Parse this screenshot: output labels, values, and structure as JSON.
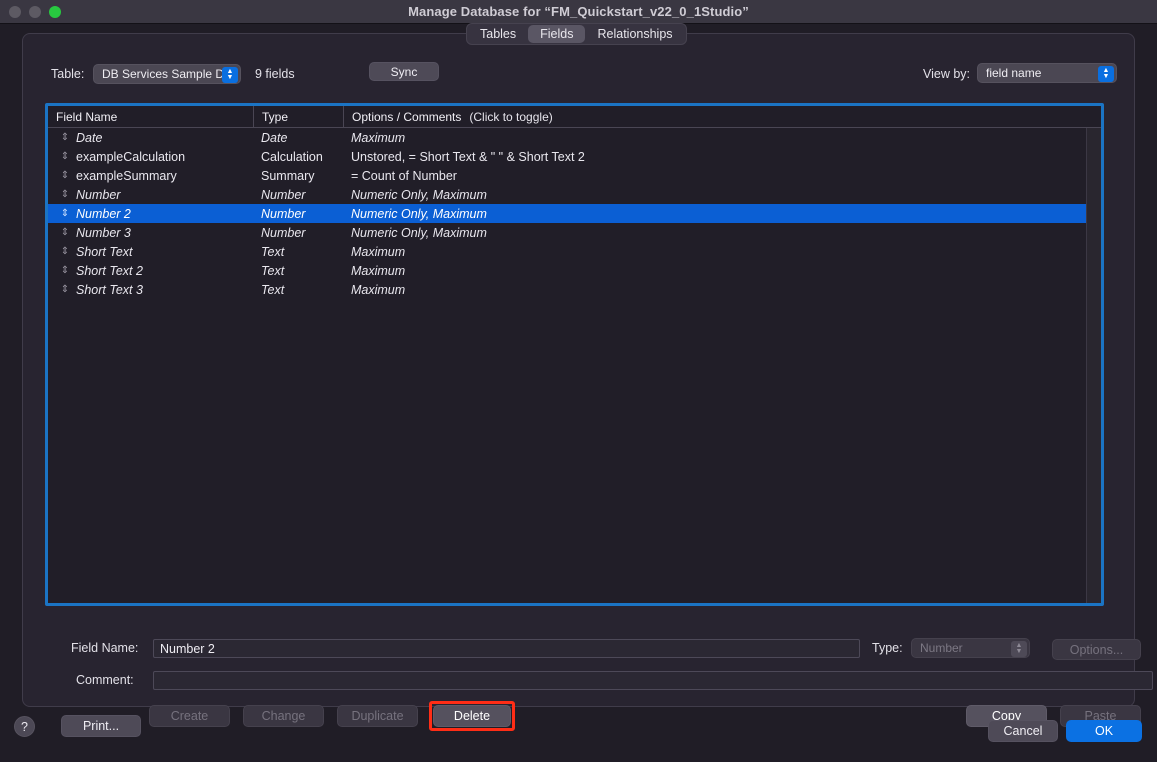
{
  "window": {
    "title": "Manage Database for “FM_Quickstart_v22_0_1Studio”",
    "traffic_lights": [
      "close",
      "minimize",
      "maximize"
    ]
  },
  "tabs": [
    {
      "label": "Tables",
      "active": false
    },
    {
      "label": "Fields",
      "active": true
    },
    {
      "label": "Relationships",
      "active": false
    }
  ],
  "toolbar": {
    "table_label": "Table:",
    "table_value": "DB Services Sample D...",
    "fields_count": "9 fields",
    "sync_label": "Sync",
    "viewby_label": "View by:",
    "viewby_value": "field name"
  },
  "list": {
    "columns": [
      "Field Name",
      "Type",
      "Options / Comments"
    ],
    "columns_hint": "(Click to toggle)",
    "rows": [
      {
        "name": "Date",
        "type": "Date",
        "options": "Maximum",
        "italic": true,
        "selected": false
      },
      {
        "name": "exampleCalculation",
        "type": "Calculation",
        "options": "Unstored, = Short Text & \" \" & Short Text 2",
        "italic": false,
        "selected": false
      },
      {
        "name": "exampleSummary",
        "type": "Summary",
        "options": "= Count of Number",
        "italic": false,
        "selected": false
      },
      {
        "name": "Number",
        "type": "Number",
        "options": "Numeric Only, Maximum",
        "italic": true,
        "selected": false
      },
      {
        "name": "Number 2",
        "type": "Number",
        "options": "Numeric Only, Maximum",
        "italic": true,
        "selected": true
      },
      {
        "name": "Number 3",
        "type": "Number",
        "options": "Numeric Only, Maximum",
        "italic": true,
        "selected": false
      },
      {
        "name": "Short Text",
        "type": "Text",
        "options": "Maximum",
        "italic": true,
        "selected": false
      },
      {
        "name": "Short Text 2",
        "type": "Text",
        "options": "Maximum",
        "italic": true,
        "selected": false
      },
      {
        "name": "Short Text 3",
        "type": "Text",
        "options": "Maximum",
        "italic": true,
        "selected": false
      }
    ],
    "drag_handle_glyph": "⇕"
  },
  "form": {
    "field_name_label": "Field Name:",
    "field_name_value": "Number 2",
    "comment_label": "Comment:",
    "comment_value": "",
    "type_label": "Type:",
    "type_value": "Number",
    "options_label": "Options..."
  },
  "actions": {
    "create": "Create",
    "change": "Change",
    "duplicate": "Duplicate",
    "delete": "Delete",
    "copy": "Copy",
    "paste": "Paste"
  },
  "footer": {
    "help": "?",
    "print": "Print...",
    "cancel": "Cancel",
    "ok": "OK"
  },
  "colors": {
    "accent_blue": "#0b5fd4",
    "highlight_ring_red": "#ff2d16",
    "focus_border": "#1b74c4",
    "ok_button": "#0b71e3",
    "window_bg": "#201d26",
    "panel_bg": "#282430"
  }
}
